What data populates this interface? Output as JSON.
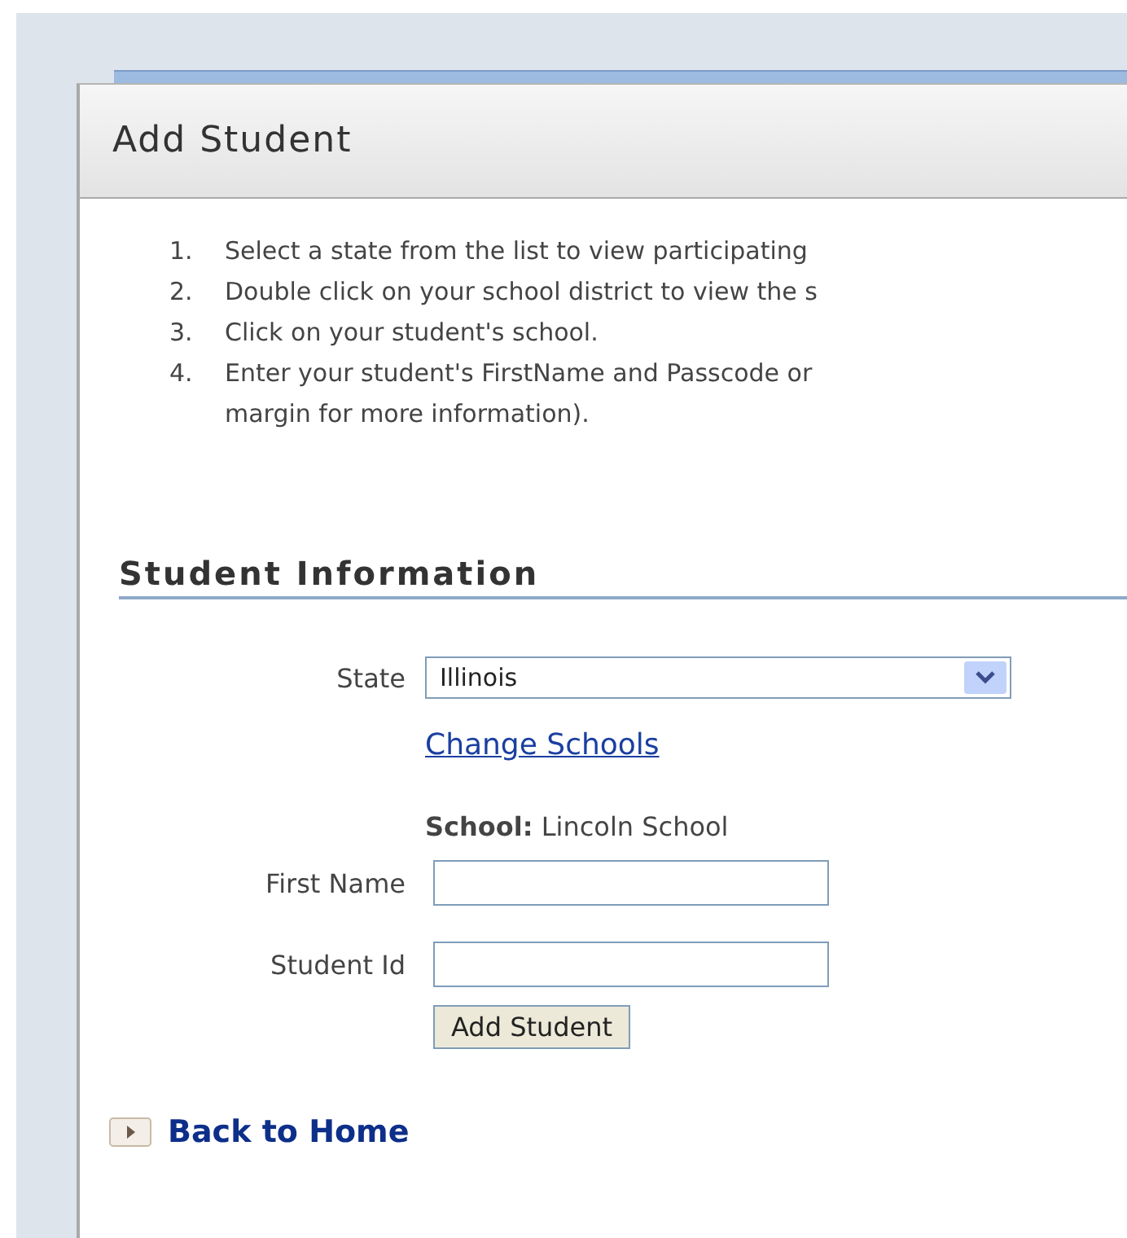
{
  "dialog": {
    "title": "Add Student"
  },
  "instructions": [
    {
      "number": "1.",
      "text": "Select a state from the list to view participating"
    },
    {
      "number": "2.",
      "text": "Double click on your school district to view the s"
    },
    {
      "number": "3.",
      "text": "Click on your student's school."
    },
    {
      "number": "4.",
      "text": "Enter your student's FirstName and Passcode or",
      "continuation": "margin for more information)."
    }
  ],
  "section": {
    "title": "Student Information"
  },
  "form": {
    "state_label": "State",
    "state_value": "Illinois",
    "change_link": "Change Schools",
    "school_label": "School:",
    "school_value": "Lincoln School",
    "fields": [
      {
        "label": "First Name"
      },
      {
        "label": "Student Id"
      }
    ],
    "submit": "Add Student"
  },
  "back_link": "Back to Home"
}
